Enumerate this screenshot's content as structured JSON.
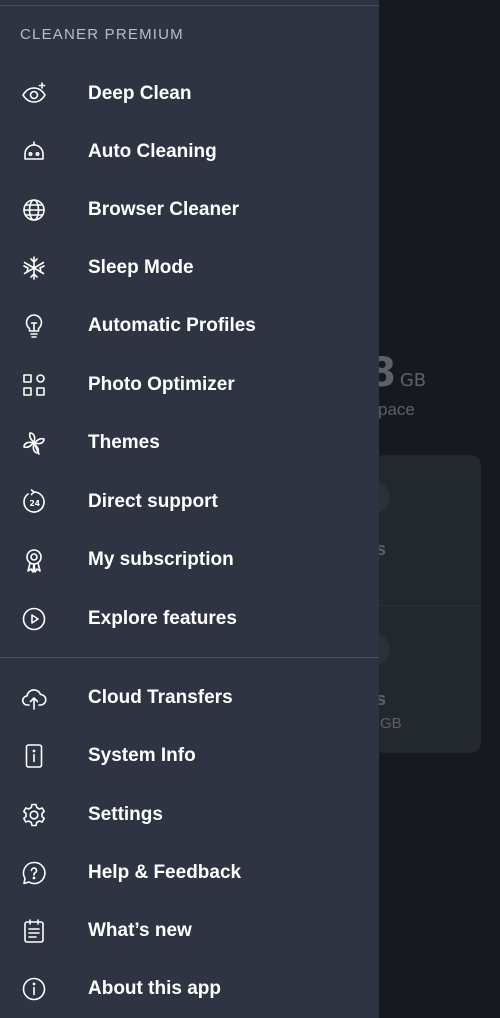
{
  "background": {
    "storage_value": "8",
    "storage_unit": "GB",
    "space_label": "pace",
    "card_text_1": "s",
    "card_text_2": "s",
    "card_gb": "GB"
  },
  "drawer": {
    "section_title": "CLEANER PREMIUM",
    "premium_items": [
      {
        "label": "Deep Clean",
        "icon": "eye-sparkle-icon"
      },
      {
        "label": "Auto Cleaning",
        "icon": "robot-icon"
      },
      {
        "label": "Browser Cleaner",
        "icon": "globe-icon"
      },
      {
        "label": "Sleep Mode",
        "icon": "snowflake-icon"
      },
      {
        "label": "Automatic Profiles",
        "icon": "lightbulb-icon"
      },
      {
        "label": "Photo Optimizer",
        "icon": "grid-icon"
      },
      {
        "label": "Themes",
        "icon": "pinwheel-icon"
      },
      {
        "label": "Direct support",
        "icon": "support-24-icon"
      },
      {
        "label": "My subscription",
        "icon": "badge-icon"
      },
      {
        "label": "Explore features",
        "icon": "play-circle-icon"
      }
    ],
    "general_items": [
      {
        "label": "Cloud Transfers",
        "icon": "cloud-upload-icon"
      },
      {
        "label": "System Info",
        "icon": "device-info-icon"
      },
      {
        "label": "Settings",
        "icon": "gear-icon"
      },
      {
        "label": "Help & Feedback",
        "icon": "help-bubble-icon"
      },
      {
        "label": "What’s new",
        "icon": "calendar-list-icon"
      },
      {
        "label": "About this app",
        "icon": "info-icon"
      }
    ]
  }
}
